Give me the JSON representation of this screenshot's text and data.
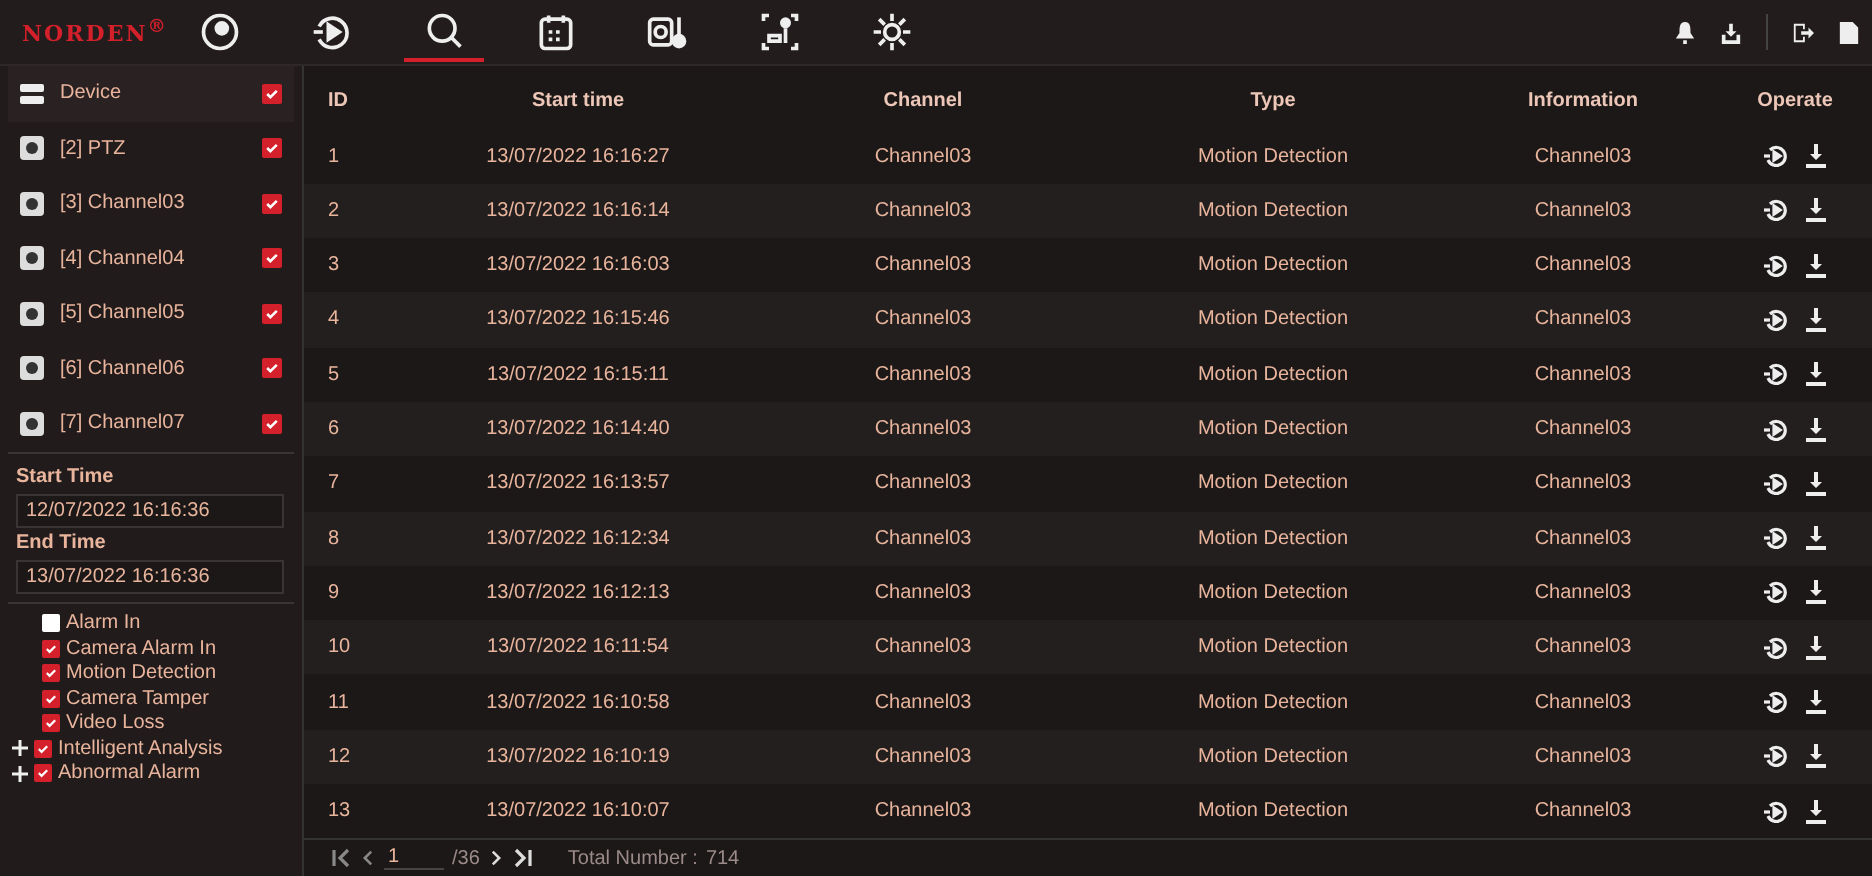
{
  "brand": {
    "logo": "NORDEN$^{®}$"
  },
  "nav_tabs": [
    {
      "kind": "record",
      "selected": false
    },
    {
      "kind": "playback",
      "selected": false
    },
    {
      "kind": "search",
      "selected": true
    },
    {
      "kind": "calendar",
      "selected": false
    },
    {
      "kind": "temperature",
      "selected": false
    },
    {
      "kind": "person",
      "selected": false
    },
    {
      "kind": "settings",
      "selected": false
    }
  ],
  "header_actions": [
    {
      "kind": "bell"
    },
    {
      "kind": "download"
    },
    {
      "kind": "logout"
    },
    {
      "kind": "file"
    }
  ],
  "devices": [
    {
      "kind": "device",
      "label": "Device",
      "checked": true
    },
    {
      "kind": "channel",
      "label": "[2] PTZ",
      "checked": true
    },
    {
      "kind": "channel",
      "label": "[3] Channel03",
      "checked": true
    },
    {
      "kind": "channel",
      "label": "[4] Channel04",
      "checked": true
    },
    {
      "kind": "channel",
      "label": "[5] Channel05",
      "checked": true
    },
    {
      "kind": "channel",
      "label": "[6] Channel06",
      "checked": true
    },
    {
      "kind": "channel",
      "label": "[7] Channel07",
      "checked": true
    }
  ],
  "start_time": {
    "label": "Start Time",
    "value": "12/07/2022 16:16:36"
  },
  "end_time": {
    "label": "End Time",
    "value": "13/07/2022 16:16:36"
  },
  "alarm_types": [
    {
      "label": "Alarm In",
      "checked": false,
      "expandable": false
    },
    {
      "label": "Camera Alarm In",
      "checked": true,
      "expandable": false
    },
    {
      "label": "Motion Detection",
      "checked": true,
      "expandable": false
    },
    {
      "label": "Camera Tamper",
      "checked": true,
      "expandable": false
    },
    {
      "label": "Video Loss",
      "checked": true,
      "expandable": false
    },
    {
      "label": "Intelligent Analysis",
      "checked": true,
      "expandable": true
    },
    {
      "label": "Abnormal Alarm",
      "checked": true,
      "expandable": true
    }
  ],
  "table": {
    "columns": [
      "ID",
      "Start time",
      "Channel",
      "Type",
      "Information",
      "Operate"
    ],
    "rows": [
      [
        "1",
        "13/07/2022 16:16:27",
        "Channel03",
        "Motion Detection",
        "Channel03"
      ],
      [
        "2",
        "13/07/2022 16:16:14",
        "Channel03",
        "Motion Detection",
        "Channel03"
      ],
      [
        "3",
        "13/07/2022 16:16:03",
        "Channel03",
        "Motion Detection",
        "Channel03"
      ],
      [
        "4",
        "13/07/2022 16:15:46",
        "Channel03",
        "Motion Detection",
        "Channel03"
      ],
      [
        "5",
        "13/07/2022 16:15:11",
        "Channel03",
        "Motion Detection",
        "Channel03"
      ],
      [
        "6",
        "13/07/2022 16:14:40",
        "Channel03",
        "Motion Detection",
        "Channel03"
      ],
      [
        "7",
        "13/07/2022 16:13:57",
        "Channel03",
        "Motion Detection",
        "Channel03"
      ],
      [
        "8",
        "13/07/2022 16:12:34",
        "Channel03",
        "Motion Detection",
        "Channel03"
      ],
      [
        "9",
        "13/07/2022 16:12:13",
        "Channel03",
        "Motion Detection",
        "Channel03"
      ],
      [
        "10",
        "13/07/2022 16:11:54",
        "Channel03",
        "Motion Detection",
        "Channel03"
      ],
      [
        "11",
        "13/07/2022 16:10:58",
        "Channel03",
        "Motion Detection",
        "Channel03"
      ],
      [
        "12",
        "13/07/2022 16:10:19",
        "Channel03",
        "Motion Detection",
        "Channel03"
      ],
      [
        "13",
        "13/07/2022 16:10:07",
        "Channel03",
        "Motion Detection",
        "Channel03"
      ]
    ]
  },
  "pagination": {
    "page": "1",
    "pages": "/36",
    "total_label": "Total Number :",
    "total": "714"
  }
}
